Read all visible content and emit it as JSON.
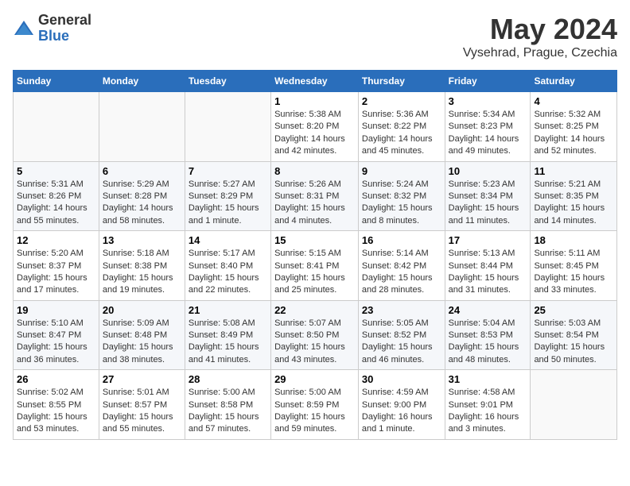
{
  "header": {
    "logo_general": "General",
    "logo_blue": "Blue",
    "month": "May 2024",
    "location": "Vysehrad, Prague, Czechia"
  },
  "weekdays": [
    "Sunday",
    "Monday",
    "Tuesday",
    "Wednesday",
    "Thursday",
    "Friday",
    "Saturday"
  ],
  "weeks": [
    [
      {
        "day": "",
        "sunrise": "",
        "sunset": "",
        "daylight": ""
      },
      {
        "day": "",
        "sunrise": "",
        "sunset": "",
        "daylight": ""
      },
      {
        "day": "",
        "sunrise": "",
        "sunset": "",
        "daylight": ""
      },
      {
        "day": "1",
        "sunrise": "Sunrise: 5:38 AM",
        "sunset": "Sunset: 8:20 PM",
        "daylight": "Daylight: 14 hours and 42 minutes."
      },
      {
        "day": "2",
        "sunrise": "Sunrise: 5:36 AM",
        "sunset": "Sunset: 8:22 PM",
        "daylight": "Daylight: 14 hours and 45 minutes."
      },
      {
        "day": "3",
        "sunrise": "Sunrise: 5:34 AM",
        "sunset": "Sunset: 8:23 PM",
        "daylight": "Daylight: 14 hours and 49 minutes."
      },
      {
        "day": "4",
        "sunrise": "Sunrise: 5:32 AM",
        "sunset": "Sunset: 8:25 PM",
        "daylight": "Daylight: 14 hours and 52 minutes."
      }
    ],
    [
      {
        "day": "5",
        "sunrise": "Sunrise: 5:31 AM",
        "sunset": "Sunset: 8:26 PM",
        "daylight": "Daylight: 14 hours and 55 minutes."
      },
      {
        "day": "6",
        "sunrise": "Sunrise: 5:29 AM",
        "sunset": "Sunset: 8:28 PM",
        "daylight": "Daylight: 14 hours and 58 minutes."
      },
      {
        "day": "7",
        "sunrise": "Sunrise: 5:27 AM",
        "sunset": "Sunset: 8:29 PM",
        "daylight": "Daylight: 15 hours and 1 minute."
      },
      {
        "day": "8",
        "sunrise": "Sunrise: 5:26 AM",
        "sunset": "Sunset: 8:31 PM",
        "daylight": "Daylight: 15 hours and 4 minutes."
      },
      {
        "day": "9",
        "sunrise": "Sunrise: 5:24 AM",
        "sunset": "Sunset: 8:32 PM",
        "daylight": "Daylight: 15 hours and 8 minutes."
      },
      {
        "day": "10",
        "sunrise": "Sunrise: 5:23 AM",
        "sunset": "Sunset: 8:34 PM",
        "daylight": "Daylight: 15 hours and 11 minutes."
      },
      {
        "day": "11",
        "sunrise": "Sunrise: 5:21 AM",
        "sunset": "Sunset: 8:35 PM",
        "daylight": "Daylight: 15 hours and 14 minutes."
      }
    ],
    [
      {
        "day": "12",
        "sunrise": "Sunrise: 5:20 AM",
        "sunset": "Sunset: 8:37 PM",
        "daylight": "Daylight: 15 hours and 17 minutes."
      },
      {
        "day": "13",
        "sunrise": "Sunrise: 5:18 AM",
        "sunset": "Sunset: 8:38 PM",
        "daylight": "Daylight: 15 hours and 19 minutes."
      },
      {
        "day": "14",
        "sunrise": "Sunrise: 5:17 AM",
        "sunset": "Sunset: 8:40 PM",
        "daylight": "Daylight: 15 hours and 22 minutes."
      },
      {
        "day": "15",
        "sunrise": "Sunrise: 5:15 AM",
        "sunset": "Sunset: 8:41 PM",
        "daylight": "Daylight: 15 hours and 25 minutes."
      },
      {
        "day": "16",
        "sunrise": "Sunrise: 5:14 AM",
        "sunset": "Sunset: 8:42 PM",
        "daylight": "Daylight: 15 hours and 28 minutes."
      },
      {
        "day": "17",
        "sunrise": "Sunrise: 5:13 AM",
        "sunset": "Sunset: 8:44 PM",
        "daylight": "Daylight: 15 hours and 31 minutes."
      },
      {
        "day": "18",
        "sunrise": "Sunrise: 5:11 AM",
        "sunset": "Sunset: 8:45 PM",
        "daylight": "Daylight: 15 hours and 33 minutes."
      }
    ],
    [
      {
        "day": "19",
        "sunrise": "Sunrise: 5:10 AM",
        "sunset": "Sunset: 8:47 PM",
        "daylight": "Daylight: 15 hours and 36 minutes."
      },
      {
        "day": "20",
        "sunrise": "Sunrise: 5:09 AM",
        "sunset": "Sunset: 8:48 PM",
        "daylight": "Daylight: 15 hours and 38 minutes."
      },
      {
        "day": "21",
        "sunrise": "Sunrise: 5:08 AM",
        "sunset": "Sunset: 8:49 PM",
        "daylight": "Daylight: 15 hours and 41 minutes."
      },
      {
        "day": "22",
        "sunrise": "Sunrise: 5:07 AM",
        "sunset": "Sunset: 8:50 PM",
        "daylight": "Daylight: 15 hours and 43 minutes."
      },
      {
        "day": "23",
        "sunrise": "Sunrise: 5:05 AM",
        "sunset": "Sunset: 8:52 PM",
        "daylight": "Daylight: 15 hours and 46 minutes."
      },
      {
        "day": "24",
        "sunrise": "Sunrise: 5:04 AM",
        "sunset": "Sunset: 8:53 PM",
        "daylight": "Daylight: 15 hours and 48 minutes."
      },
      {
        "day": "25",
        "sunrise": "Sunrise: 5:03 AM",
        "sunset": "Sunset: 8:54 PM",
        "daylight": "Daylight: 15 hours and 50 minutes."
      }
    ],
    [
      {
        "day": "26",
        "sunrise": "Sunrise: 5:02 AM",
        "sunset": "Sunset: 8:55 PM",
        "daylight": "Daylight: 15 hours and 53 minutes."
      },
      {
        "day": "27",
        "sunrise": "Sunrise: 5:01 AM",
        "sunset": "Sunset: 8:57 PM",
        "daylight": "Daylight: 15 hours and 55 minutes."
      },
      {
        "day": "28",
        "sunrise": "Sunrise: 5:00 AM",
        "sunset": "Sunset: 8:58 PM",
        "daylight": "Daylight: 15 hours and 57 minutes."
      },
      {
        "day": "29",
        "sunrise": "Sunrise: 5:00 AM",
        "sunset": "Sunset: 8:59 PM",
        "daylight": "Daylight: 15 hours and 59 minutes."
      },
      {
        "day": "30",
        "sunrise": "Sunrise: 4:59 AM",
        "sunset": "Sunset: 9:00 PM",
        "daylight": "Daylight: 16 hours and 1 minute."
      },
      {
        "day": "31",
        "sunrise": "Sunrise: 4:58 AM",
        "sunset": "Sunset: 9:01 PM",
        "daylight": "Daylight: 16 hours and 3 minutes."
      },
      {
        "day": "",
        "sunrise": "",
        "sunset": "",
        "daylight": ""
      }
    ]
  ]
}
